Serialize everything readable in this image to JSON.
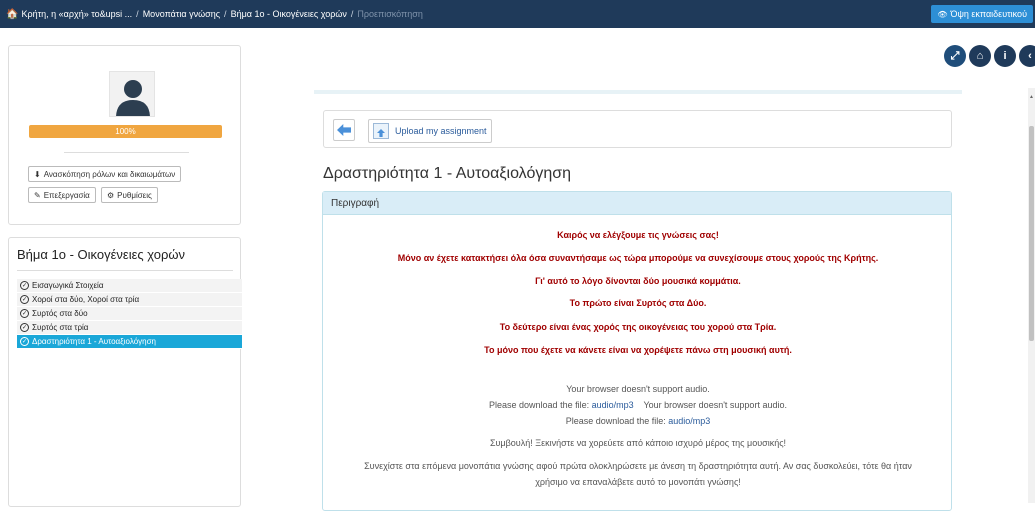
{
  "breadcrumb": {
    "items": [
      "Κρήτη, η «αρχή» το&upsi ...",
      "Μονοπάτια γνώσης",
      "Βήμα 1ο - Οικογένειες χορών"
    ],
    "current": "Προεπισκόπηση",
    "separator": "/"
  },
  "teacher_view_label": "Όψη εκπαιδευτικού",
  "profile": {
    "progress_label": "100%",
    "progress_value": 100,
    "roles_button": "Ανασκόπηση ρόλων και δικαιωμάτων",
    "edit_button": "Επεξεργασία",
    "settings_button": "Ρυθμίσεις"
  },
  "sidebar": {
    "title": "Βήμα 1ο - Οικογένειες χορών",
    "items": [
      {
        "label": "Εισαγωγικά Στοιχεία"
      },
      {
        "label": "Χοροί στα δύο, Χοροί στα τρία"
      },
      {
        "label": "Συρτός στα δύο"
      },
      {
        "label": "Συρτός στα τρία"
      },
      {
        "label": "Δραστηριότητα 1 - Αυτοαξιολόγηση"
      }
    ]
  },
  "toolbar": {
    "upload_label": "Upload my assignment"
  },
  "activity_title": "Δραστηριότητα 1 - Αυτοαξιολόγηση",
  "description": {
    "header": "Περιγραφή",
    "red_lines": [
      "Καιρός να ελέγξουμε τις γνώσεις σας!",
      "Μόνο αν έχετε κατακτήσει όλα όσα συναντήσαμε ως τώρα μπορούμε να συνεχίσουμε στους χορούς της Κρήτης.",
      "Γι' αυτό το λόγο δίνονται δύο μουσικά κομμάτια.",
      "Το πρώτο είναι Συρτός στα Δύο.",
      "Το δεύτερο είναι ένας χορός της οικογένειας του χορού στα Τρία.",
      "Το μόνο που έχετε να κάνετε είναι να χορέψετε πάνω στη μουσική αυτή."
    ],
    "audio_not_supported": "Your browser doesn't support audio.",
    "download_prefix": "Please download the file:",
    "download_link": "audio/mp3",
    "advice": "Συμβουλή! Ξεκινήστε να χορεύετε από κάποιο ισχυρό μέρος της μουσικής!",
    "continue_line1": "Συνεχίστε στα επόμενα μονοπάτια γνώσης αφού πρώτα ολοκληρώσετε με άνεση τη δραστηριότητα αυτή. Αν σας δυσκολεύει, τότε θα ήταν",
    "continue_line2": "χρήσιμο να επαναλάβετε αυτό το μονοπάτι γνώσης!"
  },
  "colors": {
    "topbar": "#1f3a5a",
    "accent": "#1aa7d8",
    "progress": "#f0a640",
    "highlight_text": "#a00000"
  },
  "icons": [
    "home-icon",
    "eye-icon",
    "expand-icon",
    "info-icon",
    "chevron-left-icon",
    "back-arrow-icon",
    "upload-icon",
    "user-avatar-icon",
    "check-circle-icon",
    "pencil-icon",
    "gear-icon",
    "download-person-icon"
  ]
}
